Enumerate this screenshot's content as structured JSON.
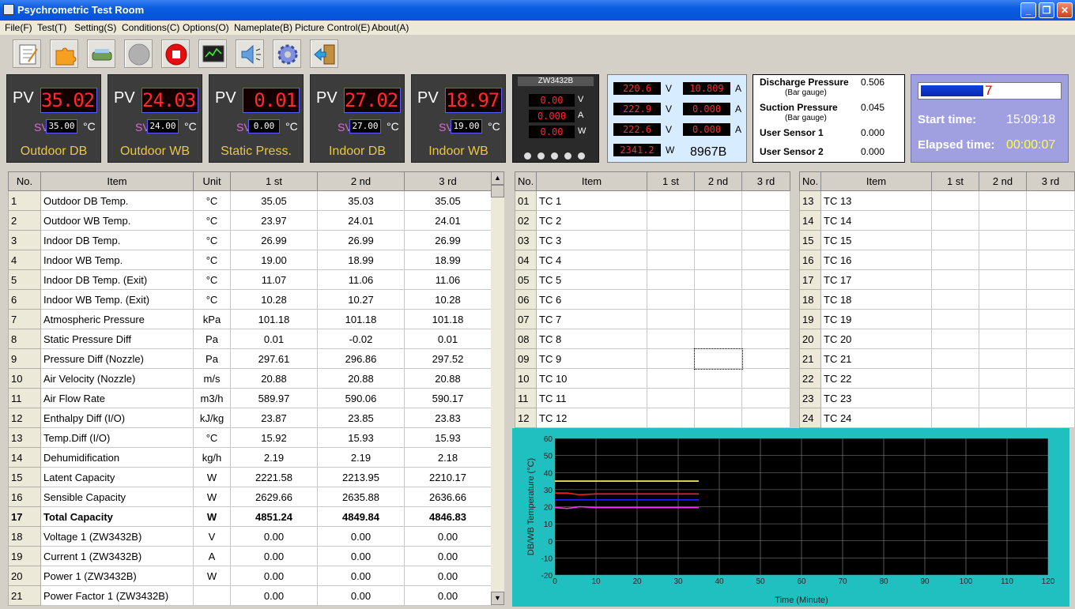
{
  "window": {
    "title": "Psychrometric Test Room"
  },
  "menu": [
    "File(F)",
    "Test(T)",
    "Setting(S)",
    "Conditions(C)",
    "Options(O)",
    "Nameplate(B)",
    "Picture Control(E)",
    "About(A)"
  ],
  "toolbar_icons": [
    "notepad-icon",
    "puzzle-icon",
    "scanner-icon",
    "stop-circle-icon",
    "record-stop-icon",
    "monitor-chart-icon",
    "speaker-icon",
    "gear-icon",
    "exit-door-icon"
  ],
  "controllers": [
    {
      "pv_label": "PV",
      "pv": "35.02",
      "sv_label": "SV",
      "sv": "35.00",
      "unit": "°C",
      "name": "Outdoor DB"
    },
    {
      "pv_label": "PV",
      "pv": "24.03",
      "sv_label": "SV",
      "sv": "24.00",
      "unit": "°C",
      "name": "Outdoor WB"
    },
    {
      "pv_label": "PV",
      "pv": "0.01",
      "sv_label": "SV",
      "sv": "0.00",
      "unit": "°C",
      "name": "Static Press."
    },
    {
      "pv_label": "PV",
      "pv": "27.02",
      "sv_label": "SV",
      "sv": "27.00",
      "unit": "°C",
      "name": "Indoor DB"
    },
    {
      "pv_label": "PV",
      "pv": "18.97",
      "sv_label": "SV",
      "sv": "19.00",
      "unit": "°C",
      "name": "Indoor WB"
    }
  ],
  "meter": {
    "model": "ZW3432B",
    "v": "0.00",
    "a": "0.000",
    "w": "0.00",
    "u_v": "V",
    "u_a": "A",
    "u_w": "W"
  },
  "power": {
    "rows": [
      {
        "v": "220.6",
        "a": "10.809"
      },
      {
        "v": "222.9",
        "a": "0.000"
      },
      {
        "v": "222.6",
        "a": "0.000"
      }
    ],
    "u_v": "V",
    "u_a": "A",
    "u_w": "W",
    "w": "2341.2",
    "model": "8967B"
  },
  "pressures": {
    "discharge_label": "Discharge Pressure",
    "discharge_sub": "(Bar gauge)",
    "discharge": "0.506",
    "suction_label": "Suction Pressure",
    "suction_sub": "(Bar gauge)",
    "suction": "0.045",
    "user1_label": "User Sensor 1",
    "user1": "0.000",
    "user2_label": "User Sensor 2",
    "user2": "0.000"
  },
  "timer": {
    "progress": 0.45,
    "progress_text": "7",
    "start_label": "Start time:",
    "start": "15:09:18",
    "elapsed_label": "Elapsed time:",
    "elapsed": "00:00:07"
  },
  "main_table": {
    "headers": [
      "No.",
      "Item",
      "Unit",
      "1 st",
      "2 nd",
      "3 rd"
    ],
    "rows": [
      [
        "1",
        "Outdoor DB Temp.",
        "°C",
        "35.05",
        "35.03",
        "35.05"
      ],
      [
        "2",
        "Outdoor WB Temp.",
        "°C",
        "23.97",
        "24.01",
        "24.01"
      ],
      [
        "3",
        "Indoor DB Temp.",
        "°C",
        "26.99",
        "26.99",
        "26.99"
      ],
      [
        "4",
        "Indoor WB Temp.",
        "°C",
        "19.00",
        "18.99",
        "18.99"
      ],
      [
        "5",
        "Indoor DB Temp. (Exit)",
        "°C",
        "11.07",
        "11.06",
        "11.06"
      ],
      [
        "6",
        "Indoor WB Temp. (Exit)",
        "°C",
        "10.28",
        "10.27",
        "10.28"
      ],
      [
        "7",
        "Atmospheric Pressure",
        "kPa",
        "101.18",
        "101.18",
        "101.18"
      ],
      [
        "8",
        "Static Pressure Diff",
        "Pa",
        "0.01",
        "-0.02",
        "0.01"
      ],
      [
        "9",
        "Pressure Diff (Nozzle)",
        "Pa",
        "297.61",
        "296.86",
        "297.52"
      ],
      [
        "10",
        "Air Velocity (Nozzle)",
        "m/s",
        "20.88",
        "20.88",
        "20.88"
      ],
      [
        "11",
        "Air Flow Rate",
        "m3/h",
        "589.97",
        "590.06",
        "590.17"
      ],
      [
        "12",
        "Enthalpy Diff (I/O)",
        "kJ/kg",
        "23.87",
        "23.85",
        "23.83"
      ],
      [
        "13",
        "Temp.Diff (I/O)",
        "°C",
        "15.92",
        "15.93",
        "15.93"
      ],
      [
        "14",
        "Dehumidification",
        "kg/h",
        "2.19",
        "2.19",
        "2.18"
      ],
      [
        "15",
        "Latent Capacity",
        "W",
        "2221.58",
        "2213.95",
        "2210.17"
      ],
      [
        "16",
        "Sensible Capacity",
        "W",
        "2629.66",
        "2635.88",
        "2636.66"
      ],
      [
        "17",
        "Total Capacity",
        "W",
        "4851.24",
        "4849.84",
        "4846.83"
      ],
      [
        "18",
        "Voltage 1 (ZW3432B)",
        "V",
        "0.00",
        "0.00",
        "0.00"
      ],
      [
        "19",
        "Current 1 (ZW3432B)",
        "A",
        "0.00",
        "0.00",
        "0.00"
      ],
      [
        "20",
        "Power 1 (ZW3432B)",
        "W",
        "0.00",
        "0.00",
        "0.00"
      ],
      [
        "21",
        "Power Factor 1 (ZW3432B)",
        "",
        "0.00",
        "0.00",
        "0.00"
      ]
    ]
  },
  "tc_table_a": {
    "headers": [
      "No.",
      "Item",
      "1 st",
      "2 nd",
      "3 rd"
    ],
    "rows": [
      [
        "01",
        "TC 1"
      ],
      [
        "02",
        "TC 2"
      ],
      [
        "03",
        "TC 3"
      ],
      [
        "04",
        "TC 4"
      ],
      [
        "05",
        "TC 5"
      ],
      [
        "06",
        "TC 6"
      ],
      [
        "07",
        "TC 7"
      ],
      [
        "08",
        "TC 8"
      ],
      [
        "09",
        "TC 9"
      ],
      [
        "10",
        "TC 10"
      ],
      [
        "11",
        "TC 11"
      ],
      [
        "12",
        "TC 12"
      ]
    ]
  },
  "tc_table_b": {
    "headers": [
      "No.",
      "Item",
      "1 st",
      "2 nd",
      "3 rd"
    ],
    "rows": [
      [
        "13",
        "TC 13"
      ],
      [
        "14",
        "TC 14"
      ],
      [
        "15",
        "TC 15"
      ],
      [
        "16",
        "TC 16"
      ],
      [
        "17",
        "TC 17"
      ],
      [
        "18",
        "TC 18"
      ],
      [
        "19",
        "TC 19"
      ],
      [
        "20",
        "TC 20"
      ],
      [
        "21",
        "TC 21"
      ],
      [
        "22",
        "TC 22"
      ],
      [
        "23",
        "TC 23"
      ],
      [
        "24",
        "TC 24"
      ]
    ]
  },
  "chart_data": {
    "type": "line",
    "xlabel": "Time (Minute)",
    "ylabel": "DB/WB Temperature (°C)",
    "xlim": [
      0,
      120
    ],
    "ylim": [
      -20,
      60
    ],
    "xticks": [
      0,
      10,
      20,
      30,
      40,
      50,
      60,
      70,
      80,
      90,
      100,
      110,
      120
    ],
    "yticks": [
      -20,
      -10,
      0,
      10,
      20,
      30,
      40,
      50,
      60
    ],
    "grid": true,
    "series": [
      {
        "color": "#ffff60",
        "points": [
          [
            0,
            35
          ],
          [
            10,
            35
          ],
          [
            20,
            35
          ],
          [
            30,
            35
          ],
          [
            35,
            35
          ]
        ]
      },
      {
        "color": "#ff2020",
        "points": [
          [
            0,
            28
          ],
          [
            3,
            28
          ],
          [
            6,
            27
          ],
          [
            10,
            27.5
          ],
          [
            20,
            27.5
          ],
          [
            35,
            27.5
          ]
        ]
      },
      {
        "color": "#2020ff",
        "points": [
          [
            0,
            24
          ],
          [
            10,
            24
          ],
          [
            20,
            24
          ],
          [
            35,
            24
          ]
        ]
      },
      {
        "color": "#ff30ff",
        "points": [
          [
            0,
            19.5
          ],
          [
            3,
            19
          ],
          [
            6,
            20
          ],
          [
            10,
            19.5
          ],
          [
            20,
            19.5
          ],
          [
            35,
            19.5
          ]
        ]
      }
    ]
  }
}
